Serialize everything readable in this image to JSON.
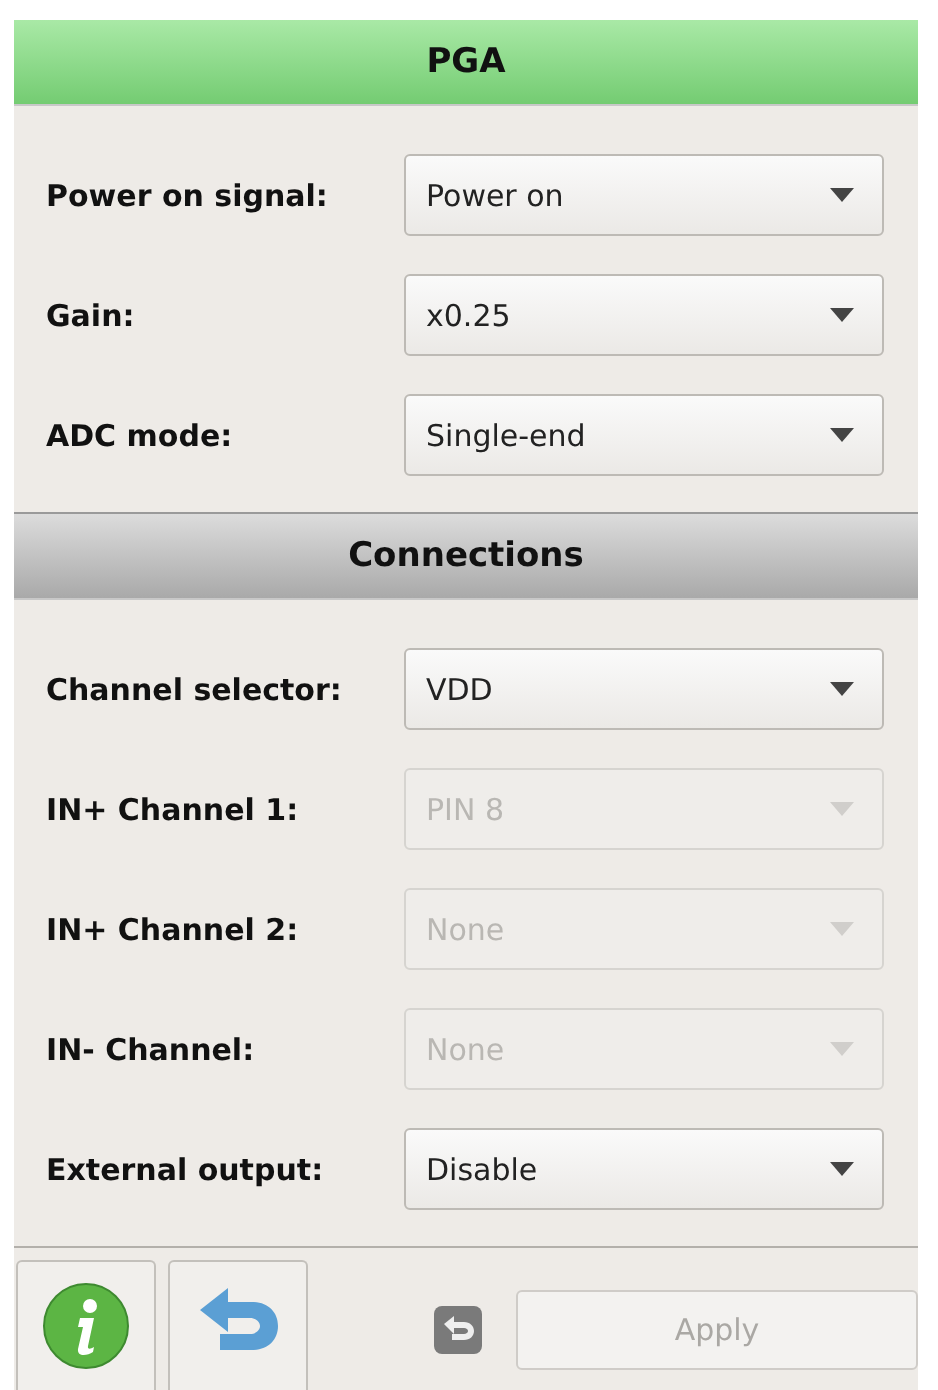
{
  "sections": [
    {
      "title": "PGA",
      "kind": "primary",
      "fields": [
        {
          "label": "Power on signal:",
          "value": "Power on",
          "disabled": false
        },
        {
          "label": "Gain:",
          "value": "x0.25",
          "disabled": false
        },
        {
          "label": "ADC mode:",
          "value": "Single-end",
          "disabled": false
        }
      ]
    },
    {
      "title": "Connections",
      "kind": "secondary",
      "fields": [
        {
          "label": "Channel selector:",
          "value": "VDD",
          "disabled": false
        },
        {
          "label": "IN+ Channel 1:",
          "value": "PIN 8",
          "disabled": true
        },
        {
          "label": "IN+ Channel 2:",
          "value": "None",
          "disabled": true
        },
        {
          "label": "IN- Channel:",
          "value": "None",
          "disabled": true
        },
        {
          "label": "External output:",
          "value": "Disable",
          "disabled": false
        }
      ]
    }
  ],
  "footer": {
    "apply": {
      "label": "Apply",
      "disabled": true
    }
  }
}
